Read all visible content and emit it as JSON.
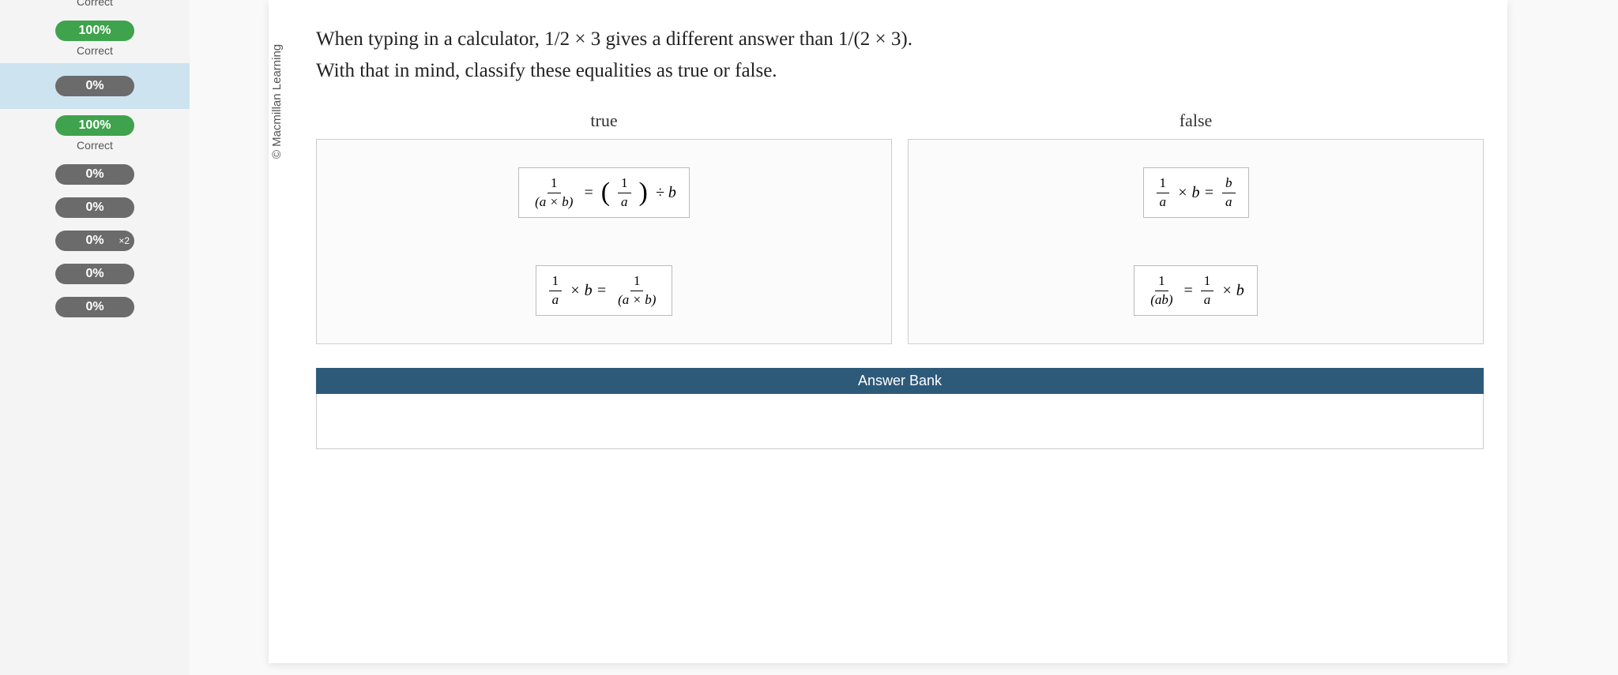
{
  "sidebar": {
    "items": [
      {
        "pct": "",
        "status": "Correct",
        "color": "green"
      },
      {
        "pct": "100%",
        "status": "Correct",
        "color": "green"
      },
      {
        "pct": "0%",
        "status": "",
        "color": "grey",
        "selected": true
      },
      {
        "pct": "100%",
        "status": "Correct",
        "color": "green"
      },
      {
        "pct": "0%",
        "status": "",
        "color": "grey"
      },
      {
        "pct": "0%",
        "status": "",
        "color": "grey"
      },
      {
        "pct": "0%",
        "status": "",
        "color": "grey",
        "mult": "×2"
      },
      {
        "pct": "0%",
        "status": "",
        "color": "grey"
      },
      {
        "pct": "0%",
        "status": "",
        "color": "grey"
      }
    ]
  },
  "copyright": "© Macmillan Learning",
  "prompt_line1": "When typing in a calculator, 1/2 × 3 gives a different answer than 1/(2 × 3).",
  "prompt_line2": "With that in mind, classify these equalities as true or false.",
  "buckets": {
    "true_label": "true",
    "false_label": "false"
  },
  "tiles": {
    "t1": {
      "lhs_num": "1",
      "lhs_den": "(a × b)",
      "eq": "=",
      "paren_num": "1",
      "paren_den": "a",
      "tail": "÷ b"
    },
    "t2": {
      "lhs_num": "1",
      "lhs_den": "a",
      "mid": "× b =",
      "rhs_num": "1",
      "rhs_den": "(a × b)"
    },
    "t3": {
      "lhs_num": "1",
      "lhs_den": "a",
      "mid": "× b =",
      "rhs_num": "b",
      "rhs_den": "a"
    },
    "t4": {
      "lhs_num": "1",
      "lhs_den": "(ab)",
      "eq": "=",
      "mid_num": "1",
      "mid_den": "a",
      "tail": "× b"
    }
  },
  "answer_bank": "Answer Bank"
}
